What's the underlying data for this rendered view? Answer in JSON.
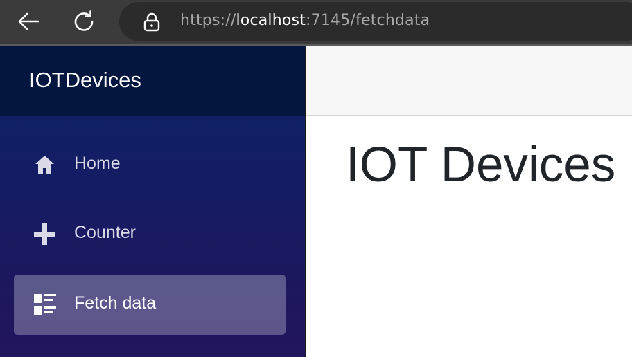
{
  "browser": {
    "url_scheme": "https://",
    "url_host": "localhost",
    "url_rest": ":7145/fetchdata"
  },
  "sidebar": {
    "brand": "IOTDevices",
    "items": [
      {
        "label": "Home",
        "icon": "home-icon",
        "active": false
      },
      {
        "label": "Counter",
        "icon": "plus-icon",
        "active": false
      },
      {
        "label": "Fetch data",
        "icon": "list-rich-icon",
        "active": true
      }
    ]
  },
  "main": {
    "title": "IOT Devices"
  }
}
